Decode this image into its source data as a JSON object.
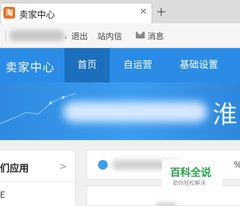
{
  "browser": {
    "tab_icon_glyph": "淘",
    "tab_title": "卖家中心",
    "close_glyph": "✕",
    "new_tab_glyph": "+"
  },
  "topbar": {
    "comma": ",",
    "logout": "退出",
    "inbox": "站内信",
    "messages": "消息"
  },
  "nav": {
    "brand": "卖家中心",
    "items": [
      "首页",
      "自运营",
      "基础设置"
    ],
    "active_index": 0
  },
  "banner": {
    "visible_char": "淮"
  },
  "side_panel": {
    "title": "们应用",
    "arrow": ">",
    "row_text": "E"
  },
  "notice": {
    "trailing_text": "%"
  },
  "watermark": {
    "main": "百科全说",
    "sub": "助你轻松解决"
  },
  "colors": {
    "nav_blue": "#2a8ce6",
    "nav_active": "#1b6fbd",
    "tab_icon": "#f26a1b",
    "watermark_green": "#24a148"
  }
}
